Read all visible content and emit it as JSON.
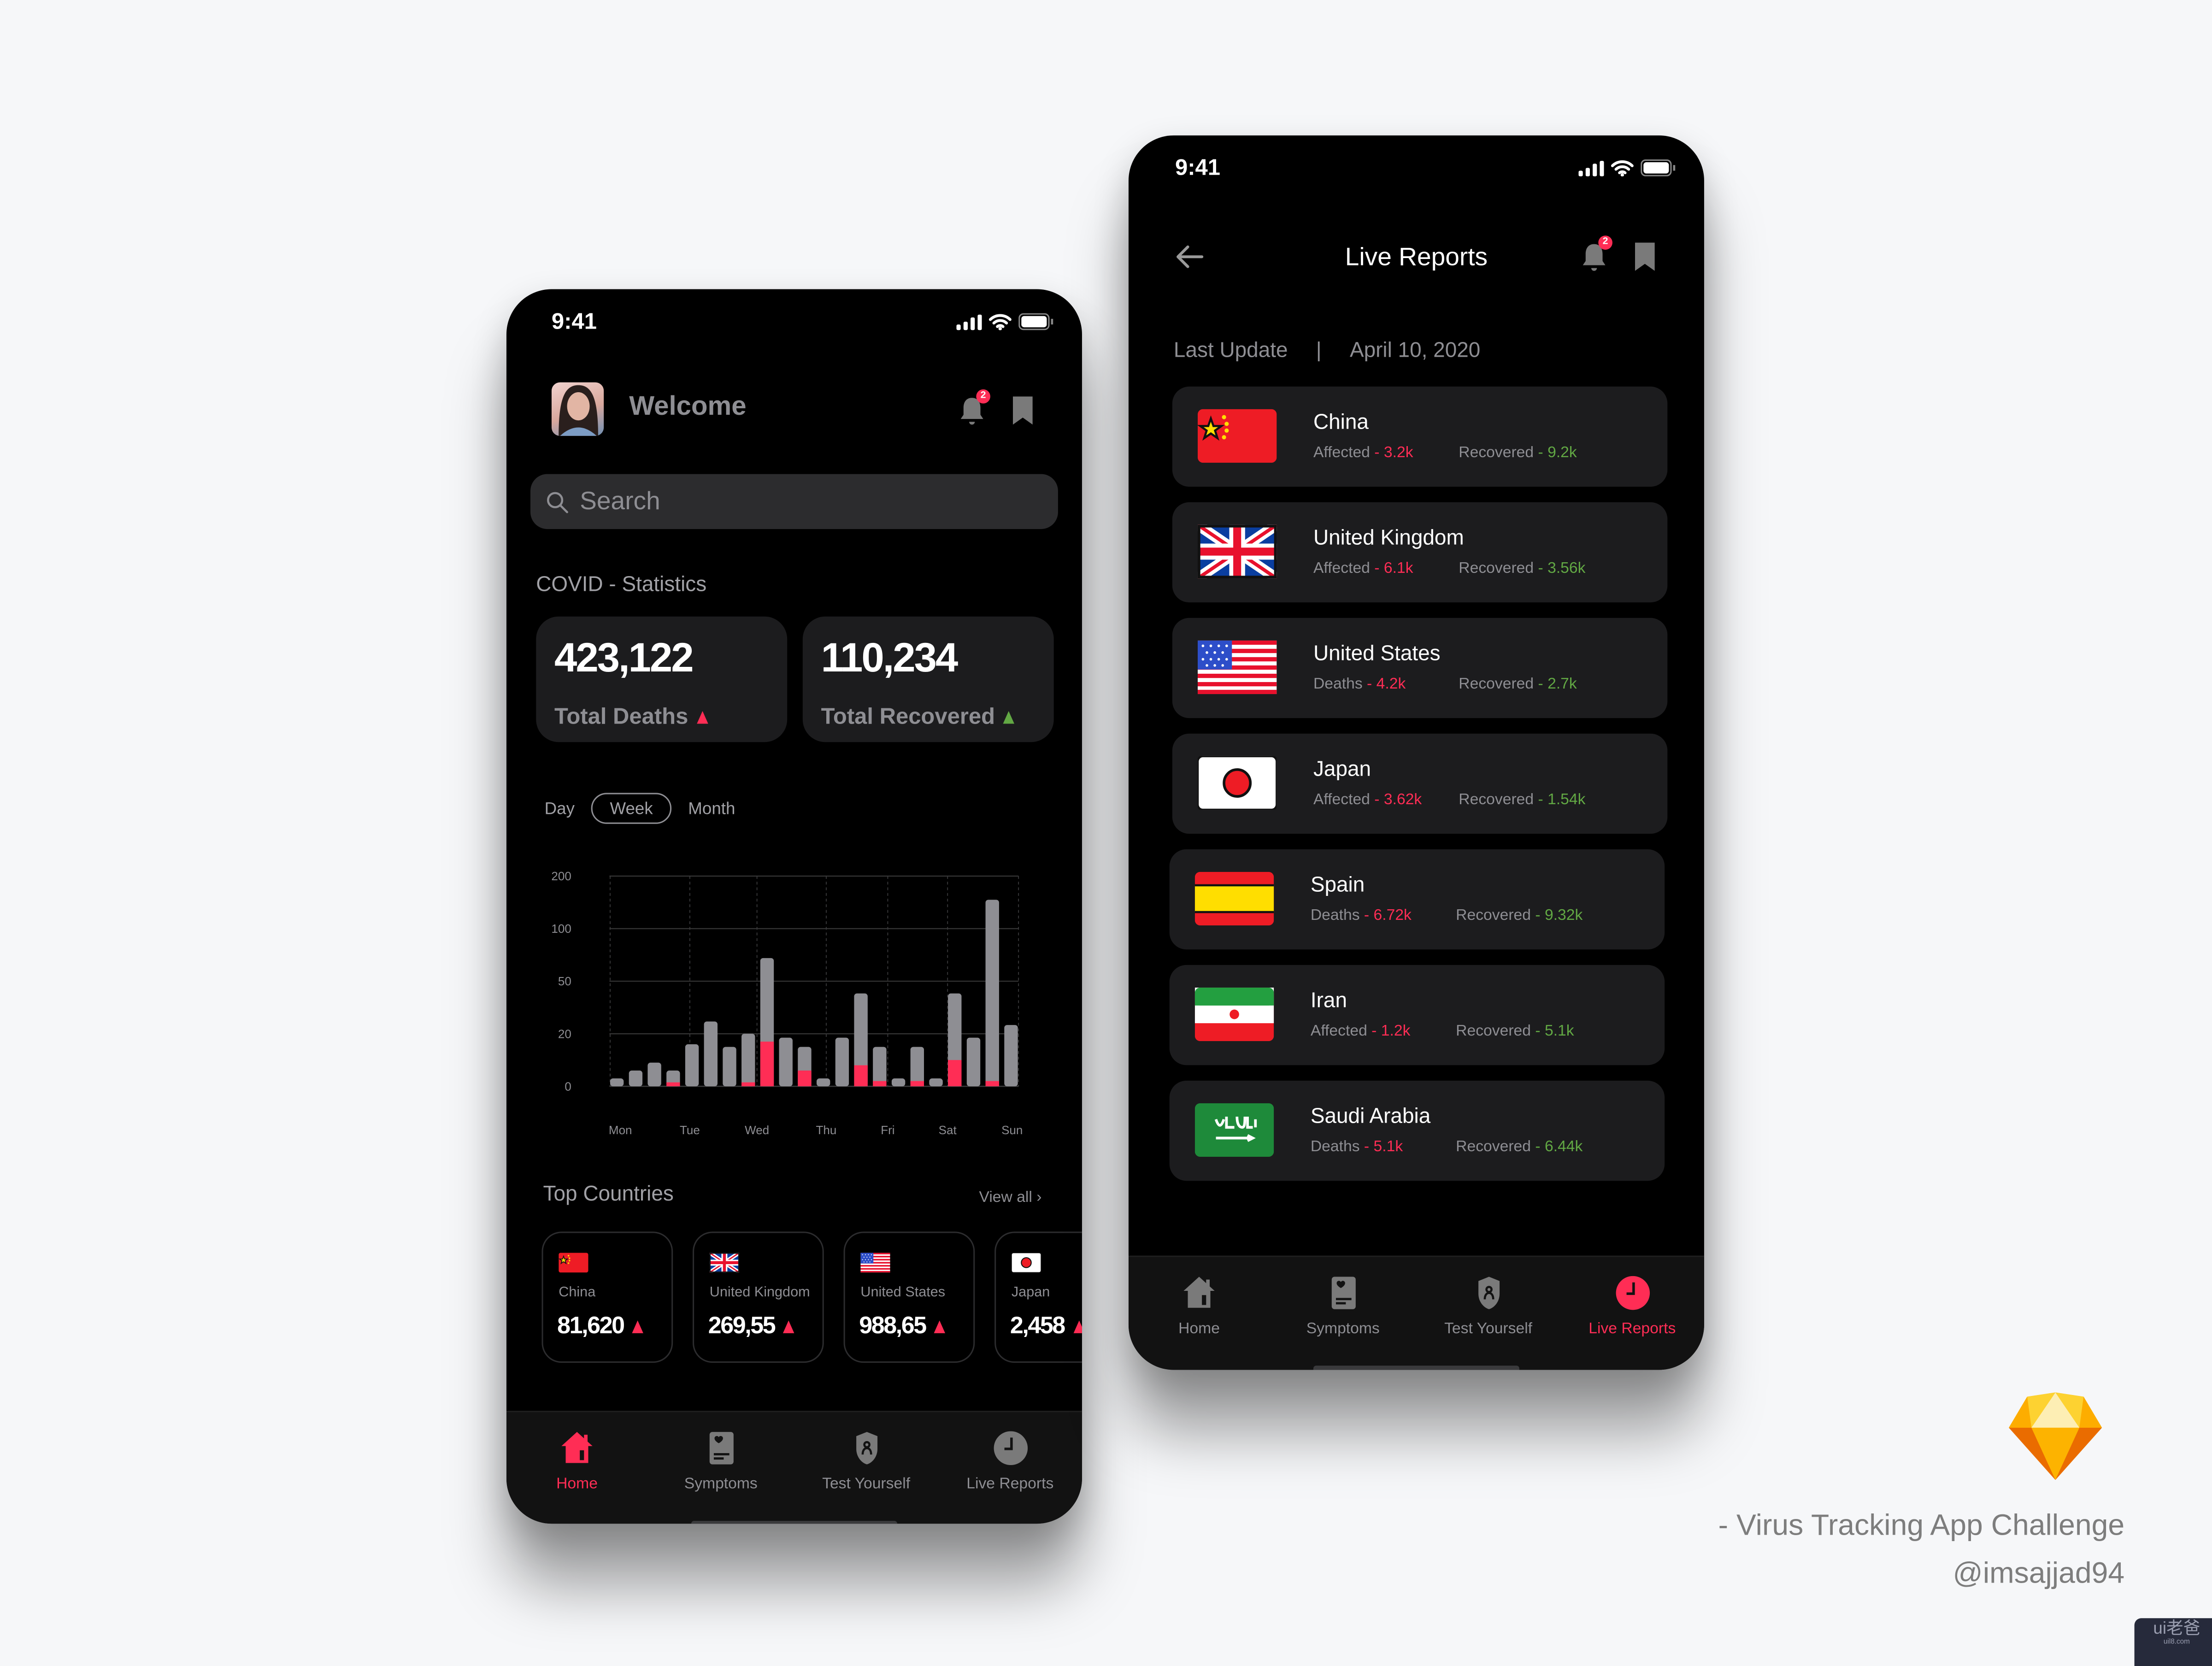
{
  "colors": {
    "accent_red": "#ff2d55",
    "recovered_green": "#62a844",
    "card_bg": "#1c1c1e",
    "tab_bar_bg": "#121212",
    "page_bg": "#f6f7f9"
  },
  "left_phone": {
    "status_time": "9:41",
    "header": {
      "welcome": "Welcome",
      "notification_count": "2",
      "avatar": "user-avatar-photo"
    },
    "search": {
      "placeholder": "Search",
      "value": ""
    },
    "stats": {
      "title": "COVID - Statistics",
      "cards": [
        {
          "value": "423,122",
          "label": "Total Deaths",
          "trend": "up",
          "trend_color": "#ff2d55"
        },
        {
          "value": "110,234",
          "label": "Total Recovered",
          "trend": "up",
          "trend_color": "#62a844"
        }
      ]
    },
    "period_tabs": {
      "items": [
        "Day",
        "Week",
        "Month"
      ],
      "selected": "Week"
    },
    "top_countries": {
      "title": "Top Countries",
      "view_all": "View all",
      "items": [
        {
          "name": "China",
          "value": "81,620",
          "flag": "china",
          "trend": "up"
        },
        {
          "name": "United Kingdom",
          "value": "269,55",
          "flag": "uk",
          "trend": "up"
        },
        {
          "name": "United States",
          "value": "988,65",
          "flag": "us",
          "trend": "up"
        },
        {
          "name": "Japan",
          "value": "2,458",
          "flag": "japan",
          "trend": "up"
        }
      ]
    },
    "tab_bar": {
      "items": [
        {
          "label": "Home",
          "icon": "home-icon"
        },
        {
          "label": "Symptoms",
          "icon": "symptoms-icon"
        },
        {
          "label": "Test Yourself",
          "icon": "shield-user-icon"
        },
        {
          "label": "Live Reports",
          "icon": "clock-icon"
        }
      ],
      "active": "Home"
    }
  },
  "right_phone": {
    "status_time": "9:41",
    "title": "Live Reports",
    "notification_count": "2",
    "last_update": {
      "label": "Last Update",
      "separator": "|",
      "date": "April 10, 2020"
    },
    "reports": [
      {
        "country": "China",
        "flag": "china",
        "stat1_label": "Affected",
        "stat1_value": "3.2k",
        "stat2_label": "Recovered",
        "stat2_value": "9.2k"
      },
      {
        "country": "United Kingdom",
        "flag": "uk",
        "stat1_label": "Affected",
        "stat1_value": "6.1k",
        "stat2_label": "Recovered",
        "stat2_value": "3.56k"
      },
      {
        "country": "United States",
        "flag": "us",
        "stat1_label": "Deaths",
        "stat1_value": "4.2k",
        "stat2_label": "Recovered",
        "stat2_value": "2.7k"
      },
      {
        "country": "Japan",
        "flag": "japan",
        "stat1_label": "Affected",
        "stat1_value": "3.62k",
        "stat2_label": "Recovered",
        "stat2_value": "1.54k"
      },
      {
        "country": "Spain",
        "flag": "spain",
        "stat1_label": "Deaths",
        "stat1_value": "6.72k",
        "stat2_label": "Recovered",
        "stat2_value": "9.32k"
      },
      {
        "country": "Iran",
        "flag": "iran",
        "stat1_label": "Affected",
        "stat1_value": "1.2k",
        "stat2_label": "Recovered",
        "stat2_value": "5.1k"
      },
      {
        "country": "Saudi Arabia",
        "flag": "saudi",
        "stat1_label": "Deaths",
        "stat1_value": "5.1k",
        "stat2_label": "Recovered",
        "stat2_value": "6.44k"
      }
    ],
    "tab_bar": {
      "items": [
        {
          "label": "Home",
          "icon": "home-icon"
        },
        {
          "label": "Symptoms",
          "icon": "symptoms-icon"
        },
        {
          "label": "Test Yourself",
          "icon": "shield-user-icon"
        },
        {
          "label": "Live Reports",
          "icon": "clock-icon"
        }
      ],
      "active": "Live Reports"
    }
  },
  "footer": {
    "caption": "- Virus Tracking App Challenge",
    "handle": "@imsajjad94",
    "logo": "sketch-diamond-logo",
    "watermark": "ui老爸",
    "watermark_sub": "uil8.com"
  },
  "chart_data": {
    "type": "bar",
    "stacked": true,
    "y_scale": "non-uniform (equal spacing between ticks)",
    "y_ticks": [
      0,
      20,
      50,
      100,
      200
    ],
    "ylim": [
      0,
      200
    ],
    "x_tick_labels": [
      "Mon",
      "Tue",
      "Wed",
      "Thu",
      "Fri",
      "Sat",
      "Sun"
    ],
    "grid": true,
    "series": [
      {
        "color": "#8e8e93",
        "values": [
          3,
          6,
          9,
          6,
          16,
          27,
          15,
          20,
          72,
          18.5,
          15,
          3,
          18.5,
          43,
          15,
          3,
          15,
          3,
          43,
          18.5,
          155,
          25
        ]
      },
      {
        "color": "#ff2d55",
        "values": [
          0,
          0,
          0,
          1.5,
          0,
          0,
          0,
          1.5,
          17,
          0,
          6,
          0,
          0,
          8,
          2,
          0,
          2,
          0,
          10,
          0,
          2,
          0
        ]
      }
    ]
  }
}
